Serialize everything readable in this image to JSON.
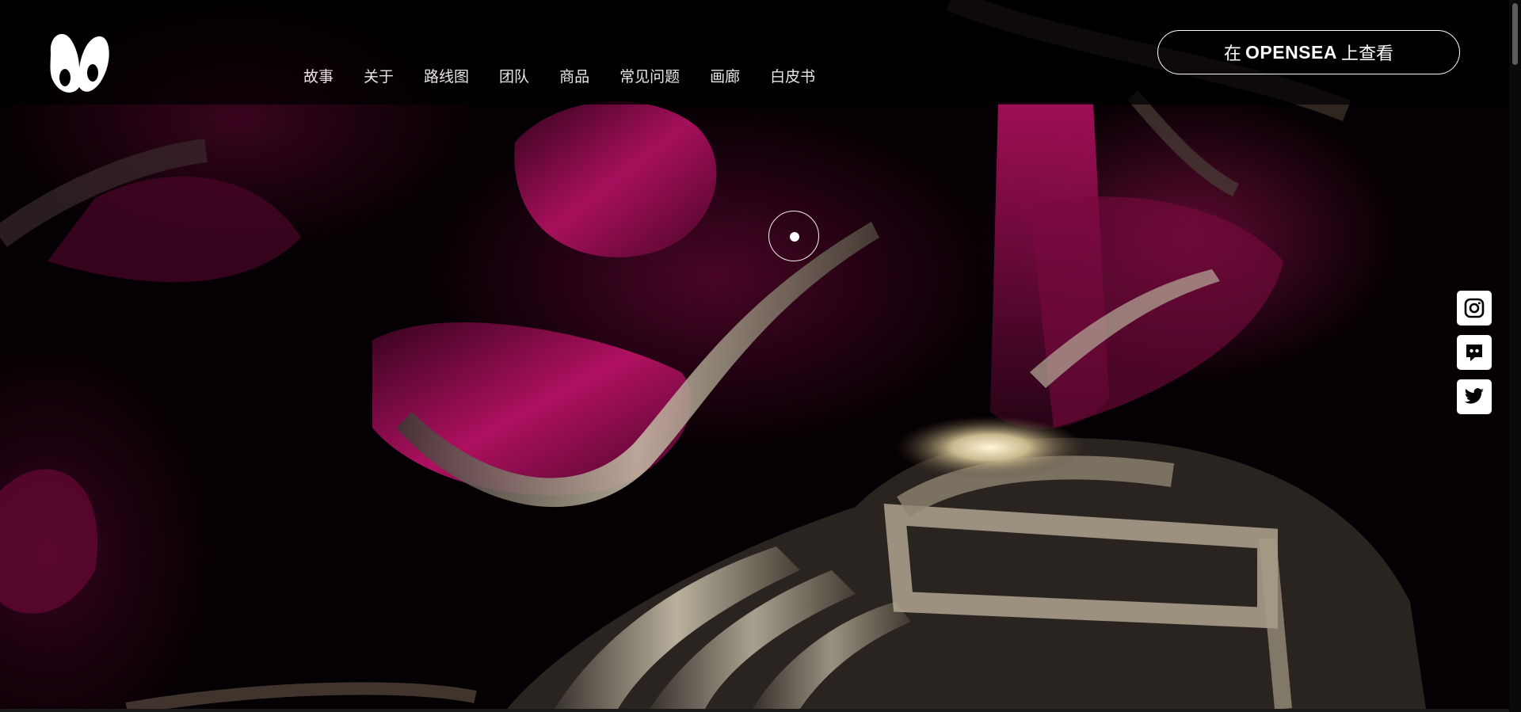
{
  "header": {
    "nav": [
      {
        "label": "故事"
      },
      {
        "label": "关于"
      },
      {
        "label": "路线图"
      },
      {
        "label": "团队"
      },
      {
        "label": "商品"
      },
      {
        "label": "常见问题"
      },
      {
        "label": "画廊"
      },
      {
        "label": "白皮书"
      }
    ],
    "cta": {
      "prefix": "在",
      "brand": "OPENSEA",
      "suffix": "上查看"
    }
  },
  "social": [
    {
      "icon": "instagram-icon"
    },
    {
      "icon": "discord-icon"
    },
    {
      "icon": "twitter-icon"
    }
  ],
  "colors": {
    "accent": "#c8106a",
    "nav_text": "#e9e4e8",
    "button_border": "#ffffff",
    "background": "#000000"
  }
}
